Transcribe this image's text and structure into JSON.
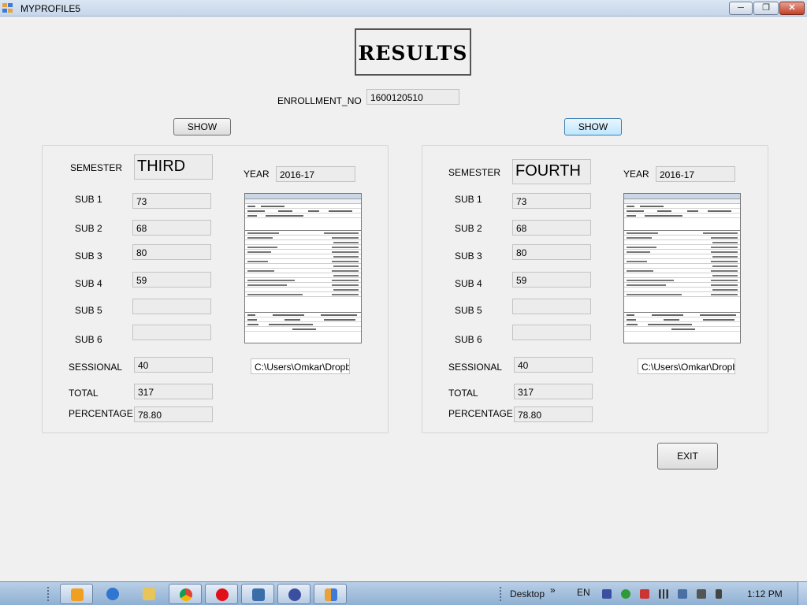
{
  "window": {
    "title": "MYPROFILE5",
    "minimize": "─",
    "maximize": "❐",
    "close": "✕"
  },
  "header": {
    "title": "RESULTS",
    "enrollment_label": "ENROLLMENT_NO",
    "enrollment_value": "1600120510"
  },
  "left": {
    "show_label": "SHOW",
    "semester_label": "SEMESTER",
    "semester_value": "THIRD",
    "year_label": "YEAR",
    "year_value": "2016-17",
    "subjects": [
      {
        "label": "SUB 1",
        "value": "73"
      },
      {
        "label": "SUB 2",
        "value": "68"
      },
      {
        "label": "SUB 3",
        "value": "80"
      },
      {
        "label": "SUB 4",
        "value": "59"
      },
      {
        "label": "SUB 5",
        "value": ""
      },
      {
        "label": "SUB 6",
        "value": ""
      }
    ],
    "sessional_label": "SESSIONAL",
    "sessional_value": "40",
    "total_label": "TOTAL",
    "total_value": "317",
    "percentage_label": "PERCENTAGE",
    "percentage_value": "78.80",
    "path_value": "C:\\Users\\Omkar\\Dropbo:"
  },
  "right": {
    "show_label": "SHOW",
    "semester_label": "SEMESTER",
    "semester_value": "FOURTH",
    "year_label": "YEAR",
    "year_value": "2016-17",
    "subjects": [
      {
        "label": "SUB 1",
        "value": "73"
      },
      {
        "label": "SUB 2",
        "value": "68"
      },
      {
        "label": "SUB 3",
        "value": "80"
      },
      {
        "label": "SUB 4",
        "value": "59"
      },
      {
        "label": "SUB 5",
        "value": ""
      },
      {
        "label": "SUB 6",
        "value": ""
      }
    ],
    "sessional_label": "SESSIONAL",
    "sessional_value": "40",
    "total_label": "TOTAL",
    "total_value": "317",
    "percentage_label": "PERCENTAGE",
    "percentage_value": "78.80",
    "path_value": "C:\\Users\\Omkar\\Dropbo:"
  },
  "exit_label": "EXIT",
  "taskbar": {
    "apps": [
      "media-player-icon",
      "internet-explorer-icon",
      "file-explorer-icon",
      "chrome-icon",
      "opera-icon",
      "remote-desktop-icon",
      "infinity-app-icon",
      "myprofile5-app-icon"
    ],
    "desktop_label": "Desktop",
    "desktop_chevron": "»",
    "language": "EN",
    "clock": "1:12 PM"
  },
  "colors": {
    "taskbar": "#a4c0df",
    "show_active": "#bee6fd",
    "panel_border": "#d5d5d5"
  }
}
